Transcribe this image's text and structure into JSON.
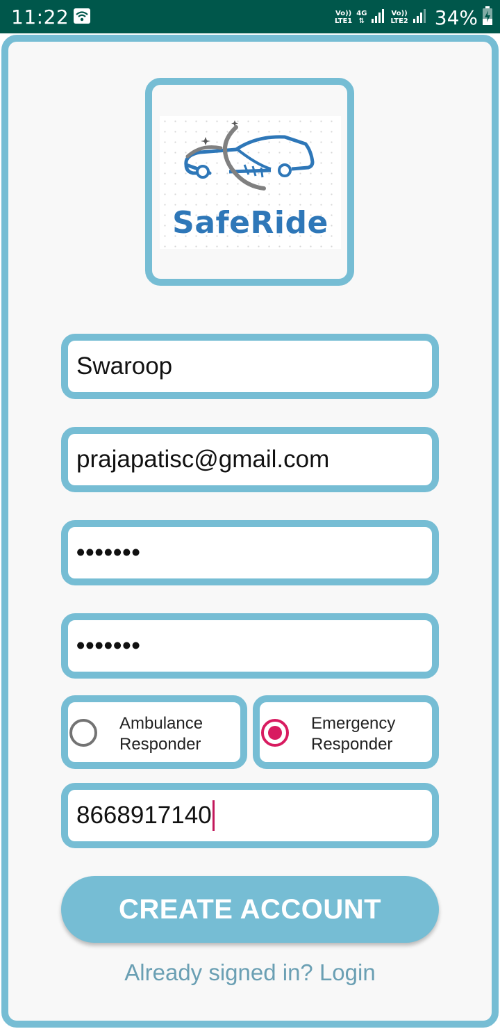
{
  "status_bar": {
    "time": "11:22",
    "battery_percent": "34%",
    "sim1_label_top": "Vo))",
    "sim1_label_bottom": "LTE1",
    "net_label": "4G",
    "sim2_label_top": "Vo))",
    "sim2_label_bottom": "LTE2"
  },
  "logo": {
    "text": "SafeRide",
    "text_color": "#2e77b8",
    "car_color": "#2e77b8",
    "orbit_color": "#808080"
  },
  "form": {
    "name_value": "Swaroop",
    "email_value": "prajapatisc@gmail.com",
    "password_value": "•••••••",
    "confirm_password_value": "•••••••",
    "role_options": [
      {
        "label": "Ambulance\nResponder",
        "selected": false
      },
      {
        "label": "Emergency\nResponder",
        "selected": true
      }
    ],
    "phone_value": "8668917140"
  },
  "create_account_label": "CREATE ACCOUNT",
  "login_link_label": "Already signed in? Login",
  "colors": {
    "accent": "#76bdd4",
    "status_bar": "#00574b",
    "radio_selected": "#d81b60",
    "link": "#6a9fb3"
  }
}
